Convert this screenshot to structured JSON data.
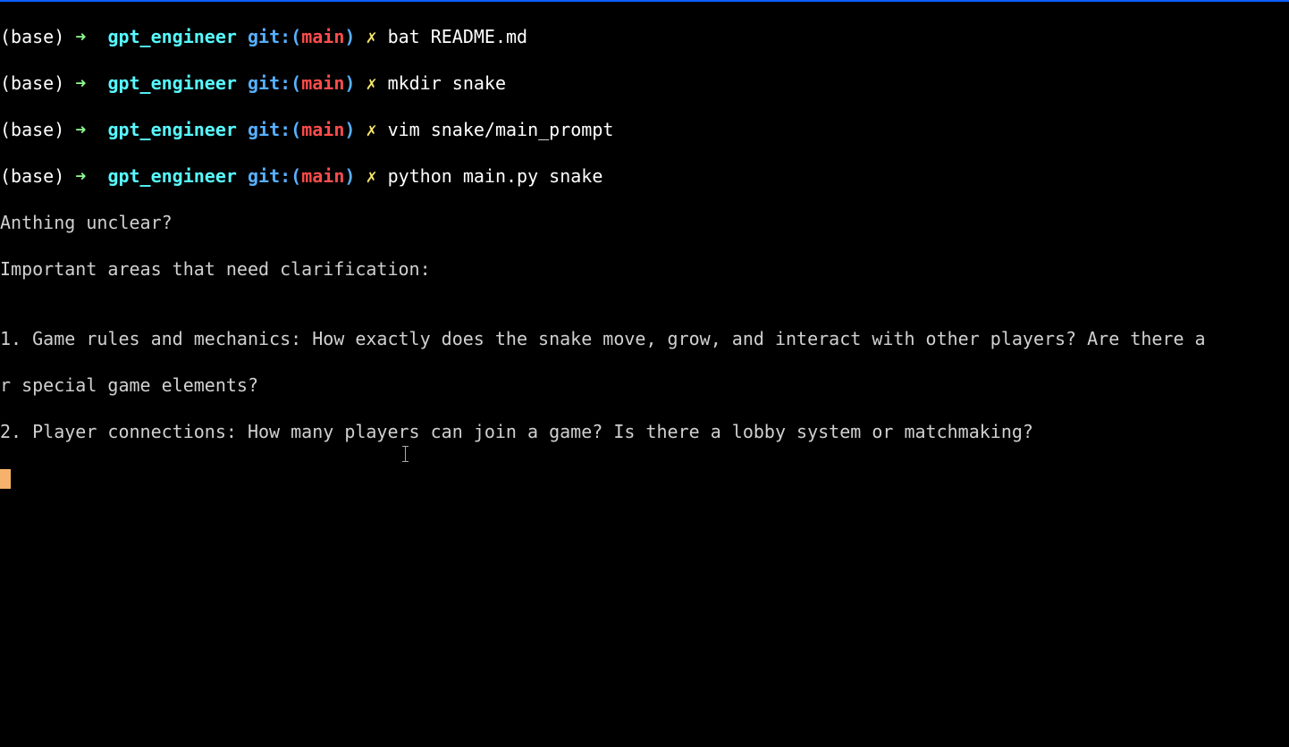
{
  "prompt": {
    "base": "(base)",
    "arrow": "➜",
    "dir": "gpt_engineer",
    "gitlabel": "git:",
    "gitparen_open": "(",
    "gitbranch": "main",
    "gitparen_close": ")",
    "dirty": "✗"
  },
  "commands": [
    "bat README.md",
    "mkdir snake",
    "vim snake/main_prompt",
    "python main.py snake"
  ],
  "output": {
    "q": "Anthing unclear?",
    "heading": "Important areas that need clarification:",
    "blank": "",
    "item1": "1. Game rules and mechanics: How exactly does the snake move, grow, and interact with other players? Are there a",
    "item1b": "r special game elements?",
    "item2": "2. Player connections: How many players can join a game? Is there a lobby system or matchmaking?"
  }
}
